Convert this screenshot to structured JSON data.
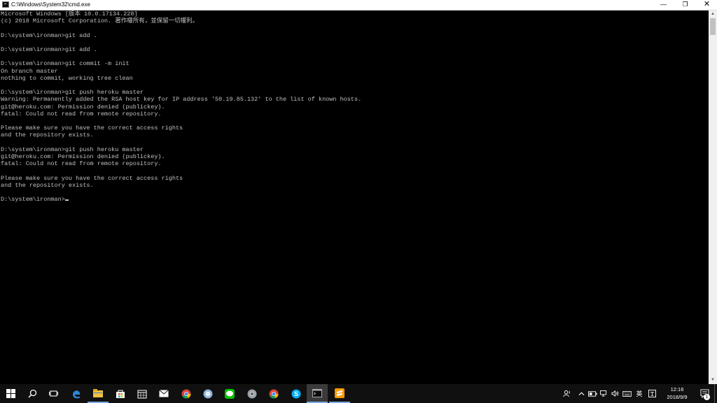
{
  "window": {
    "title": "C:\\Windows\\System32\\cmd.exe",
    "minimize": "—",
    "restore": "❐",
    "close": "✕"
  },
  "console": {
    "text": "Microsoft Windows [版本 10.0.17134.228]\n(c) 2018 Microsoft Corporation. 著作權所有，並保留一切權利。\n\nD:\\system\\ironman>git add .\n\nD:\\system\\ironman>git add .\n\nD:\\system\\ironman>git commit -m init\nOn branch master\nnothing to commit, working tree clean\n\nD:\\system\\ironman>git push heroku master\nWarning: Permanently added the RSA host key for IP address '50.19.85.132' to the list of known hosts.\ngit@heroku.com: Permission denied (publickey).\nfatal: Could not read from remote repository.\n\nPlease make sure you have the correct access rights\nand the repository exists.\n\nD:\\system\\ironman>git push heroku master\ngit@heroku.com: Permission denied (publickey).\nfatal: Could not read from remote repository.\n\nPlease make sure you have the correct access rights\nand the repository exists.\n\nD:\\system\\ironman>"
  },
  "scrollbar": {
    "up": "▲",
    "down": "▼"
  },
  "taskbar": {
    "items": [
      {
        "name": "start-button",
        "icon": "windows-logo-icon"
      },
      {
        "name": "search-button",
        "icon": "search-icon"
      },
      {
        "name": "task-view-button",
        "icon": "task-view-icon"
      },
      {
        "name": "edge-button",
        "icon": "edge-icon"
      },
      {
        "name": "file-explorer-button",
        "icon": "folder-icon"
      },
      {
        "name": "store-button",
        "icon": "store-icon"
      },
      {
        "name": "calendar-button",
        "icon": "calendar-icon"
      },
      {
        "name": "mail-button",
        "icon": "mail-icon"
      },
      {
        "name": "chrome-button",
        "icon": "chrome-icon"
      },
      {
        "name": "app-button",
        "icon": "app-icon"
      },
      {
        "name": "line-button",
        "icon": "line-icon"
      },
      {
        "name": "chrome-alt-button",
        "icon": "chrome-icon"
      },
      {
        "name": "chrome-2-button",
        "icon": "chrome-icon"
      },
      {
        "name": "skype-button",
        "icon": "skype-icon"
      },
      {
        "name": "cmd-button",
        "icon": "cmd-icon"
      },
      {
        "name": "sublime-button",
        "icon": "sublime-icon"
      }
    ],
    "tray": {
      "ime_mode": "英",
      "clock_time": "12:16",
      "clock_date": "2018/9/9",
      "notification_count": "1"
    }
  },
  "colors": {
    "console_bg": "#000000",
    "console_fg": "#c0c0c0",
    "taskbar_bg": "#101010",
    "accent": "#7aa7e0"
  }
}
